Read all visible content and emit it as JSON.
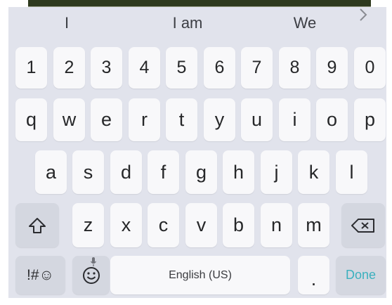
{
  "suggestions": [
    "I",
    "I am",
    "We"
  ],
  "suggestion_more_icon": "chevron-right-icon",
  "keyboard": {
    "number_row": [
      "1",
      "2",
      "3",
      "4",
      "5",
      "6",
      "7",
      "8",
      "9",
      "0"
    ],
    "row1": [
      "q",
      "w",
      "e",
      "r",
      "t",
      "y",
      "u",
      "i",
      "o",
      "p"
    ],
    "row2": [
      "a",
      "s",
      "d",
      "f",
      "g",
      "h",
      "j",
      "k",
      "l"
    ],
    "row3": [
      "z",
      "x",
      "c",
      "v",
      "b",
      "n",
      "m"
    ],
    "shift_icon": "shift-icon",
    "backspace_icon": "backspace-icon",
    "symbols_label": "!#☺",
    "emoji_icon": "emoji-icon",
    "mic_icon": "microphone-icon",
    "space_label": "English (US)",
    "period_label": ".",
    "done_label": "Done"
  },
  "colors": {
    "keyboard_bg": "#e1e3ec",
    "key_bg": "#f8f8fa",
    "function_key_bg": "#d4d7e0",
    "done_accent": "#3bb0be"
  }
}
